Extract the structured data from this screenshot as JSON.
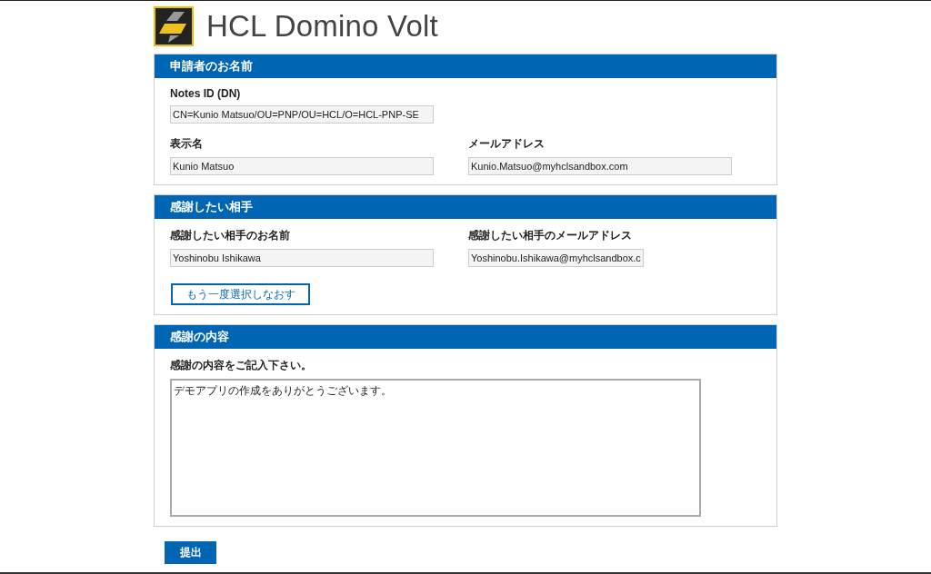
{
  "app_title": "HCL Domino Volt",
  "sections": [
    {
      "title": "申請者のお名前",
      "rows": [
        [
          {
            "label": "Notes ID (DN)",
            "value": "CN=Kunio Matsuo/OU=PNP/OU=HCL/O=HCL-PNP-SE",
            "kind": "field"
          }
        ],
        [
          {
            "label": "表示名",
            "value": "Kunio Matsuo",
            "kind": "field"
          },
          {
            "label": "メールアドレス",
            "value": "Kunio.Matsuo@myhclsandbox.com",
            "kind": "field"
          }
        ]
      ]
    },
    {
      "title": "感謝したい相手",
      "rows": [
        [
          {
            "label": "感謝したい相手のお名前",
            "value": "Yoshinobu Ishikawa",
            "kind": "field"
          },
          {
            "label": "感謝したい相手のメールアドレス",
            "value": "Yoshinobu.Ishikawa@myhclsandbox.c",
            "kind": "short"
          }
        ]
      ],
      "button": "もう一度選択しなおす"
    },
    {
      "title": "感謝の内容",
      "rows": [
        [
          {
            "label": "感謝の内容をご記入下さい。",
            "value": "デモアプリの作成をありがとうございます。",
            "kind": "textarea"
          }
        ]
      ]
    }
  ],
  "submit": "提出"
}
